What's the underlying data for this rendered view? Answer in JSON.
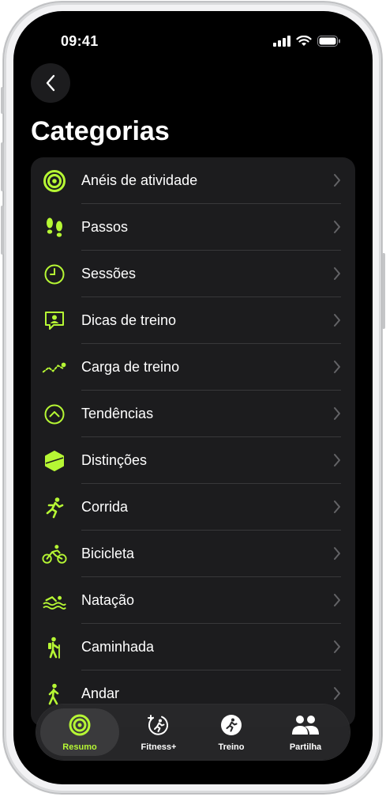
{
  "status_bar": {
    "time": "09:41"
  },
  "header": {
    "title": "Categorias"
  },
  "categories": [
    {
      "label": "Anéis de atividade",
      "icon": "activity-rings-icon"
    },
    {
      "label": "Passos",
      "icon": "footprints-icon"
    },
    {
      "label": "Sessões",
      "icon": "clock-icon"
    },
    {
      "label": "Dicas de treino",
      "icon": "coach-tips-icon"
    },
    {
      "label": "Carga de treino",
      "icon": "training-load-icon"
    },
    {
      "label": "Tendências",
      "icon": "trends-icon"
    },
    {
      "label": "Distinções",
      "icon": "awards-icon"
    },
    {
      "label": "Corrida",
      "icon": "running-icon"
    },
    {
      "label": "Bicicleta",
      "icon": "cycling-icon"
    },
    {
      "label": "Natação",
      "icon": "swimming-icon"
    },
    {
      "label": "Caminhada",
      "icon": "hiking-icon"
    },
    {
      "label": "Andar",
      "icon": "walking-icon"
    }
  ],
  "tab_bar": {
    "tabs": [
      {
        "label": "Resumo",
        "icon": "summary-rings-icon",
        "active": true
      },
      {
        "label": "Fitness+",
        "icon": "fitness-plus-icon",
        "active": false
      },
      {
        "label": "Treino",
        "icon": "workout-icon",
        "active": false
      },
      {
        "label": "Partilha",
        "icon": "sharing-icon",
        "active": false
      }
    ]
  },
  "colors": {
    "accent": "#b6f734",
    "background": "#000000",
    "list_background": "#1c1c1e",
    "separator": "#38383a"
  }
}
